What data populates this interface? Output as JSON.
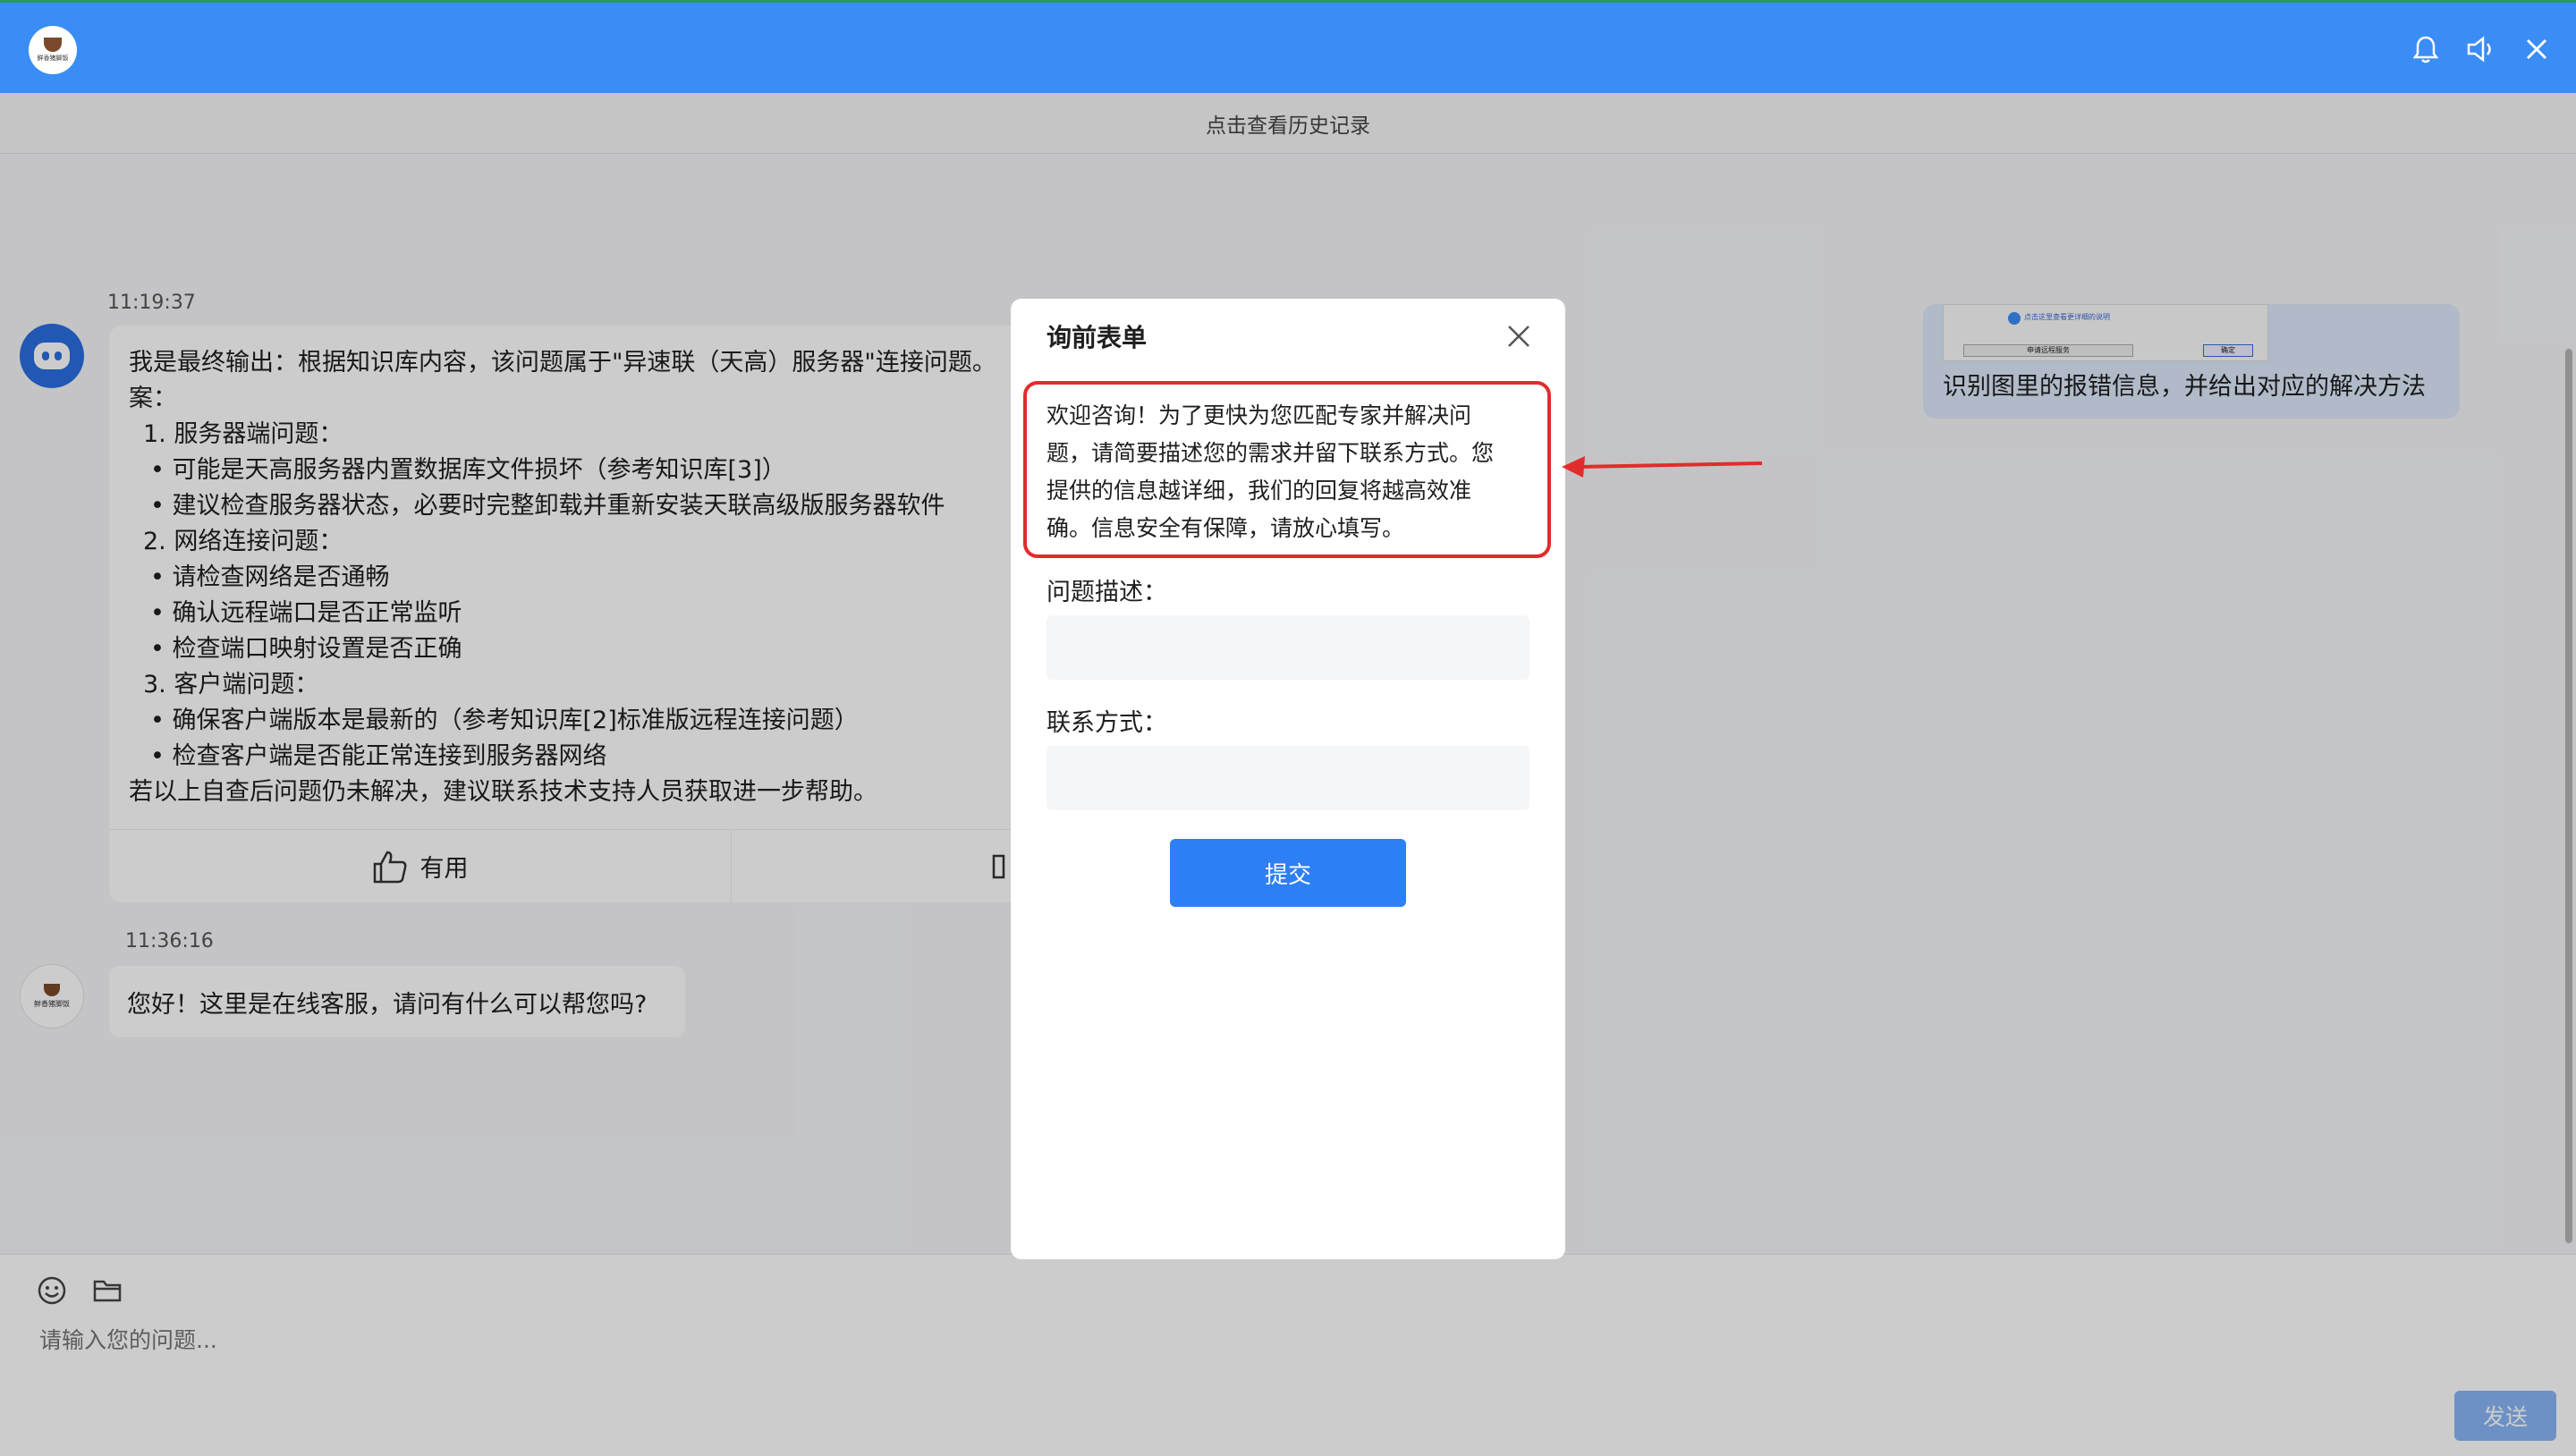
{
  "header": {
    "logo_text": "鲜香猪脚饭",
    "icons": [
      "bell-icon",
      "speaker-icon",
      "close-icon"
    ],
    "accent": "#3a8df5"
  },
  "history_link": "点击查看历史记录",
  "user_message": {
    "text": "识别图里的报错信息，并给出对应的解决方法",
    "image_lines": [
      "点击这里查看更详细的说明",
      "申请远程服务",
      "确定"
    ]
  },
  "bot_message": {
    "time": "11:19:37",
    "lines": [
      "我是最终输出：根据知识库内容，该问题属于\"异速联（天高）服务器\"连接问题。",
      "案：",
      "1. 服务器端问题：",
      "• 可能是天高服务器内置数据库文件损坏（参考知识库[3]）",
      "• 建议检查服务器状态，必要时完整卸载并重新安装天联高级版服务器软件",
      "2. 网络连接问题：",
      "• 请检查网络是否通畅",
      "• 确认远程端口是否正常监听",
      "• 检查端口映射设置是否正确",
      "3. 客户端问题：",
      "• 确保客户端版本是最新的（参考知识库[2]标准版远程连接问题）",
      "• 检查客户端是否能正常连接到服务器网络",
      "若以上自查后问题仍未解决，建议联系技术支持人员获取进一步帮助。"
    ],
    "useful_label": "有用"
  },
  "cs_message": {
    "time": "11:36:16",
    "avatar_text": "鲜香猪脚饭",
    "text": "您好！这里是在线客服，请问有什么可以帮您吗?"
  },
  "input": {
    "placeholder": "请输入您的问题...",
    "send_label": "发送",
    "tools": [
      "emoji-icon",
      "folder-icon"
    ]
  },
  "modal": {
    "title": "询前表单",
    "notice_lines": [
      "欢迎咨询！为了更快为您匹配专家并解决问",
      "题，请简要描述您的需求并留下联系方式。您",
      "提供的信息越详细，我们的回复将越高效准",
      "确。信息安全有保障，请放心填写。"
    ],
    "field1_label": "问题描述：",
    "field1_value": "",
    "field2_label": "联系方式：",
    "field2_value": "",
    "submit_label": "提交",
    "highlight_color": "#e22c2c"
  }
}
